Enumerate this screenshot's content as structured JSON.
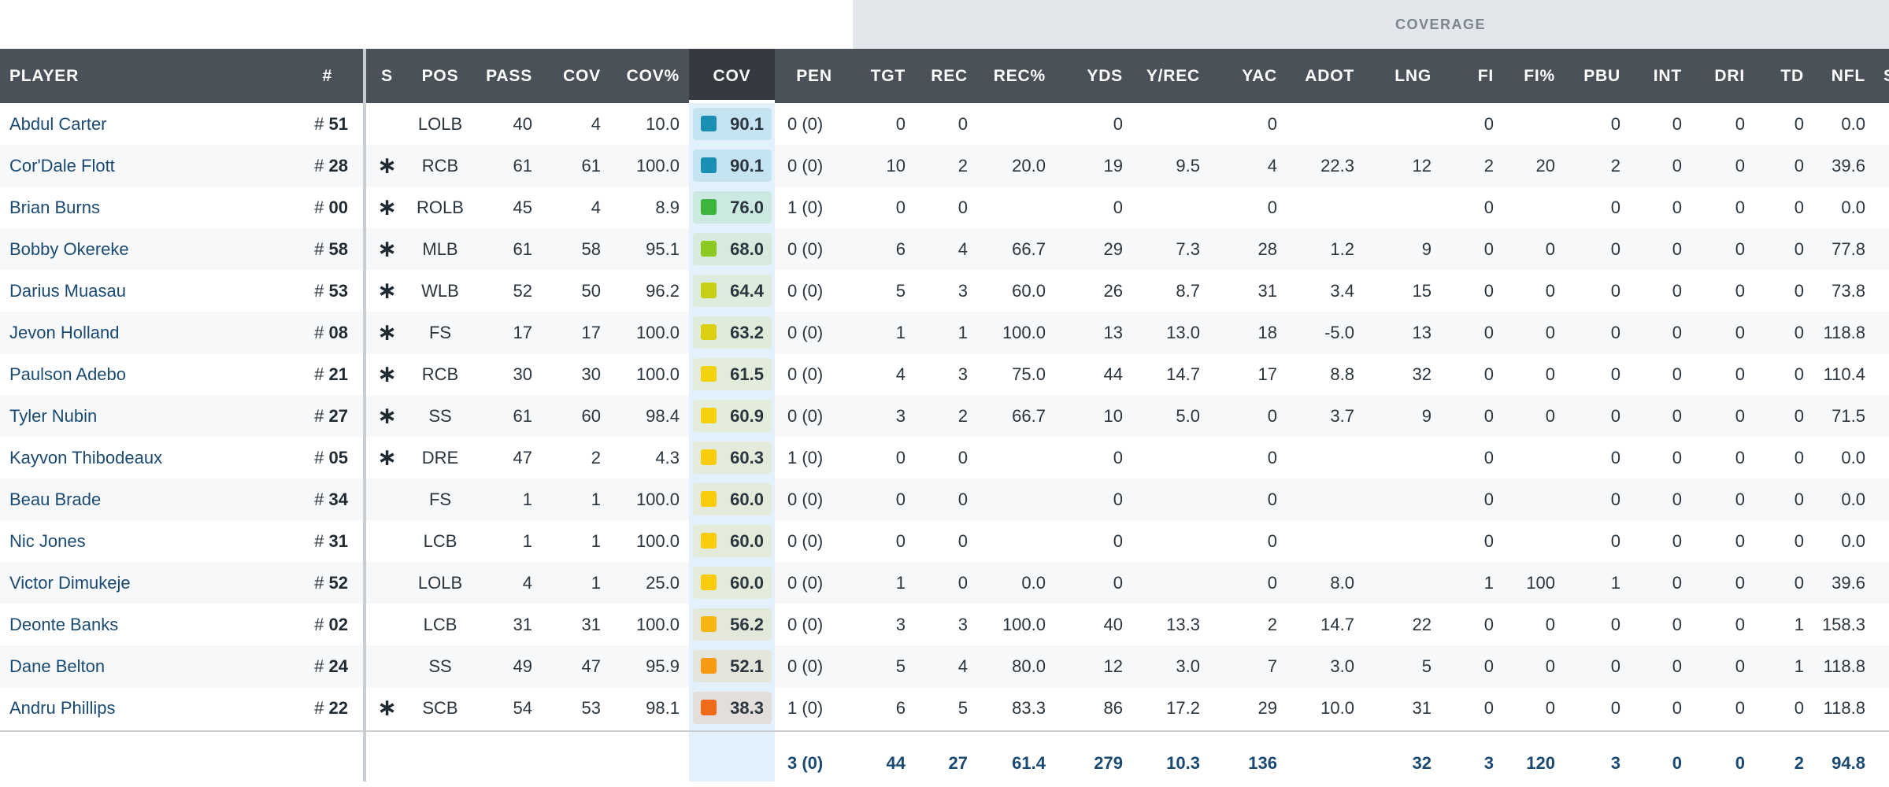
{
  "group_label": "COVERAGE",
  "columns": {
    "player": "PLAYER",
    "num": "#",
    "s": "S",
    "pos": "POS",
    "pass": "PASS",
    "cov_snaps": "COV",
    "cov_pct": "COV%",
    "cov_grade": "COV",
    "pen": "PEN",
    "tgt": "TGT",
    "rec": "REC",
    "rec_pct": "REC%",
    "yds": "YDS",
    "y_rec": "Y/REC",
    "yac": "YAC",
    "adot": "ADOT",
    "lng": "LNG",
    "fi": "FI",
    "fi_pct": "FI%",
    "pbu": "PBU",
    "int": "INT",
    "dri": "DRI",
    "td": "TD",
    "nfl": "NFL",
    "more": "S"
  },
  "starter_glyph": "∗",
  "jersey_prefix": "#",
  "rows": [
    {
      "player": "Abdul Carter",
      "num": "51",
      "starter": false,
      "pos": "LOLB",
      "pass": "40",
      "cov": "4",
      "cov_pct": "10.0",
      "grade": "90.1",
      "grade_color": "#1a8fb3",
      "pen": "0 (0)",
      "tgt": "0",
      "rec": "0",
      "rec_pct": "",
      "yds": "0",
      "y_rec": "",
      "yac": "0",
      "adot": "",
      "lng": "",
      "fi": "0",
      "fi_pct": "",
      "pbu": "0",
      "int": "0",
      "dri": "0",
      "td": "0",
      "nfl": "0.0"
    },
    {
      "player": "Cor'Dale Flott",
      "num": "28",
      "starter": true,
      "pos": "RCB",
      "pass": "61",
      "cov": "61",
      "cov_pct": "100.0",
      "grade": "90.1",
      "grade_color": "#1a8fb3",
      "pen": "0 (0)",
      "tgt": "10",
      "rec": "2",
      "rec_pct": "20.0",
      "yds": "19",
      "y_rec": "9.5",
      "yac": "4",
      "adot": "22.3",
      "lng": "12",
      "fi": "2",
      "fi_pct": "20",
      "pbu": "2",
      "int": "0",
      "dri": "0",
      "td": "0",
      "nfl": "39.6"
    },
    {
      "player": "Brian Burns",
      "num": "00",
      "starter": true,
      "pos": "ROLB",
      "pass": "45",
      "cov": "4",
      "cov_pct": "8.9",
      "grade": "76.0",
      "grade_color": "#3db53a",
      "pen": "1 (0)",
      "tgt": "0",
      "rec": "0",
      "rec_pct": "",
      "yds": "0",
      "y_rec": "",
      "yac": "0",
      "adot": "",
      "lng": "",
      "fi": "0",
      "fi_pct": "",
      "pbu": "0",
      "int": "0",
      "dri": "0",
      "td": "0",
      "nfl": "0.0"
    },
    {
      "player": "Bobby Okereke",
      "num": "58",
      "starter": true,
      "pos": "MLB",
      "pass": "61",
      "cov": "58",
      "cov_pct": "95.1",
      "grade": "68.0",
      "grade_color": "#8cc820",
      "pen": "0 (0)",
      "tgt": "6",
      "rec": "4",
      "rec_pct": "66.7",
      "yds": "29",
      "y_rec": "7.3",
      "yac": "28",
      "adot": "1.2",
      "lng": "9",
      "fi": "0",
      "fi_pct": "0",
      "pbu": "0",
      "int": "0",
      "dri": "0",
      "td": "0",
      "nfl": "77.8"
    },
    {
      "player": "Darius Muasau",
      "num": "53",
      "starter": true,
      "pos": "WLB",
      "pass": "52",
      "cov": "50",
      "cov_pct": "96.2",
      "grade": "64.4",
      "grade_color": "#c6cf13",
      "pen": "0 (0)",
      "tgt": "5",
      "rec": "3",
      "rec_pct": "60.0",
      "yds": "26",
      "y_rec": "8.7",
      "yac": "31",
      "adot": "3.4",
      "lng": "15",
      "fi": "0",
      "fi_pct": "0",
      "pbu": "0",
      "int": "0",
      "dri": "0",
      "td": "0",
      "nfl": "73.8"
    },
    {
      "player": "Jevon Holland",
      "num": "08",
      "starter": true,
      "pos": "FS",
      "pass": "17",
      "cov": "17",
      "cov_pct": "100.0",
      "grade": "63.2",
      "grade_color": "#dccf10",
      "pen": "0 (0)",
      "tgt": "1",
      "rec": "1",
      "rec_pct": "100.0",
      "yds": "13",
      "y_rec": "13.0",
      "yac": "18",
      "adot": "-5.0",
      "lng": "13",
      "fi": "0",
      "fi_pct": "0",
      "pbu": "0",
      "int": "0",
      "dri": "0",
      "td": "0",
      "nfl": "118.8"
    },
    {
      "player": "Paulson Adebo",
      "num": "21",
      "starter": true,
      "pos": "RCB",
      "pass": "30",
      "cov": "30",
      "cov_pct": "100.0",
      "grade": "61.5",
      "grade_color": "#f2d20c",
      "pen": "0 (0)",
      "tgt": "4",
      "rec": "3",
      "rec_pct": "75.0",
      "yds": "44",
      "y_rec": "14.7",
      "yac": "17",
      "adot": "8.8",
      "lng": "32",
      "fi": "0",
      "fi_pct": "0",
      "pbu": "0",
      "int": "0",
      "dri": "0",
      "td": "0",
      "nfl": "110.4"
    },
    {
      "player": "Tyler Nubin",
      "num": "27",
      "starter": true,
      "pos": "SS",
      "pass": "61",
      "cov": "60",
      "cov_pct": "98.4",
      "grade": "60.9",
      "grade_color": "#f7d00c",
      "pen": "0 (0)",
      "tgt": "3",
      "rec": "2",
      "rec_pct": "66.7",
      "yds": "10",
      "y_rec": "5.0",
      "yac": "0",
      "adot": "3.7",
      "lng": "9",
      "fi": "0",
      "fi_pct": "0",
      "pbu": "0",
      "int": "0",
      "dri": "0",
      "td": "0",
      "nfl": "71.5"
    },
    {
      "player": "Kayvon Thibodeaux",
      "num": "05",
      "starter": true,
      "pos": "DRE",
      "pass": "47",
      "cov": "2",
      "cov_pct": "4.3",
      "grade": "60.3",
      "grade_color": "#f9cd0c",
      "pen": "1 (0)",
      "tgt": "0",
      "rec": "0",
      "rec_pct": "",
      "yds": "0",
      "y_rec": "",
      "yac": "0",
      "adot": "",
      "lng": "",
      "fi": "0",
      "fi_pct": "",
      "pbu": "0",
      "int": "0",
      "dri": "0",
      "td": "0",
      "nfl": "0.0"
    },
    {
      "player": "Beau Brade",
      "num": "34",
      "starter": false,
      "pos": "FS",
      "pass": "1",
      "cov": "1",
      "cov_pct": "100.0",
      "grade": "60.0",
      "grade_color": "#f9cc0c",
      "pen": "0 (0)",
      "tgt": "0",
      "rec": "0",
      "rec_pct": "",
      "yds": "0",
      "y_rec": "",
      "yac": "0",
      "adot": "",
      "lng": "",
      "fi": "0",
      "fi_pct": "",
      "pbu": "0",
      "int": "0",
      "dri": "0",
      "td": "0",
      "nfl": "0.0"
    },
    {
      "player": "Nic Jones",
      "num": "31",
      "starter": false,
      "pos": "LCB",
      "pass": "1",
      "cov": "1",
      "cov_pct": "100.0",
      "grade": "60.0",
      "grade_color": "#f9cc0c",
      "pen": "0 (0)",
      "tgt": "0",
      "rec": "0",
      "rec_pct": "",
      "yds": "0",
      "y_rec": "",
      "yac": "0",
      "adot": "",
      "lng": "",
      "fi": "0",
      "fi_pct": "",
      "pbu": "0",
      "int": "0",
      "dri": "0",
      "td": "0",
      "nfl": "0.0"
    },
    {
      "player": "Victor Dimukeje",
      "num": "52",
      "starter": false,
      "pos": "LOLB",
      "pass": "4",
      "cov": "1",
      "cov_pct": "25.0",
      "grade": "60.0",
      "grade_color": "#f9cc0c",
      "pen": "0 (0)",
      "tgt": "1",
      "rec": "0",
      "rec_pct": "0.0",
      "yds": "0",
      "y_rec": "",
      "yac": "0",
      "adot": "8.0",
      "lng": "",
      "fi": "1",
      "fi_pct": "100",
      "pbu": "1",
      "int": "0",
      "dri": "0",
      "td": "0",
      "nfl": "39.6"
    },
    {
      "player": "Deonte Banks",
      "num": "02",
      "starter": false,
      "pos": "LCB",
      "pass": "31",
      "cov": "31",
      "cov_pct": "100.0",
      "grade": "56.2",
      "grade_color": "#f7b50f",
      "pen": "0 (0)",
      "tgt": "3",
      "rec": "3",
      "rec_pct": "100.0",
      "yds": "40",
      "y_rec": "13.3",
      "yac": "2",
      "adot": "14.7",
      "lng": "22",
      "fi": "0",
      "fi_pct": "0",
      "pbu": "0",
      "int": "0",
      "dri": "0",
      "td": "1",
      "nfl": "158.3"
    },
    {
      "player": "Dane Belton",
      "num": "24",
      "starter": false,
      "pos": "SS",
      "pass": "49",
      "cov": "47",
      "cov_pct": "95.9",
      "grade": "52.1",
      "grade_color": "#f79a12",
      "pen": "0 (0)",
      "tgt": "5",
      "rec": "4",
      "rec_pct": "80.0",
      "yds": "12",
      "y_rec": "3.0",
      "yac": "7",
      "adot": "3.0",
      "lng": "5",
      "fi": "0",
      "fi_pct": "0",
      "pbu": "0",
      "int": "0",
      "dri": "0",
      "td": "1",
      "nfl": "118.8"
    },
    {
      "player": "Andru Phillips",
      "num": "22",
      "starter": true,
      "pos": "SCB",
      "pass": "54",
      "cov": "53",
      "cov_pct": "98.1",
      "grade": "38.3",
      "grade_color": "#f06a18",
      "pen": "1 (0)",
      "tgt": "6",
      "rec": "5",
      "rec_pct": "83.3",
      "yds": "86",
      "y_rec": "17.2",
      "yac": "29",
      "adot": "10.0",
      "lng": "31",
      "fi": "0",
      "fi_pct": "0",
      "pbu": "0",
      "int": "0",
      "dri": "0",
      "td": "0",
      "nfl": "118.8"
    }
  ],
  "totals": {
    "pen": "3 (0)",
    "tgt": "44",
    "rec": "27",
    "rec_pct": "61.4",
    "yds": "279",
    "y_rec": "10.3",
    "yac": "136",
    "lng": "32",
    "fi": "3",
    "fi_pct": "120",
    "pbu": "3",
    "int": "0",
    "dri": "0",
    "td": "2",
    "nfl": "94.8"
  }
}
